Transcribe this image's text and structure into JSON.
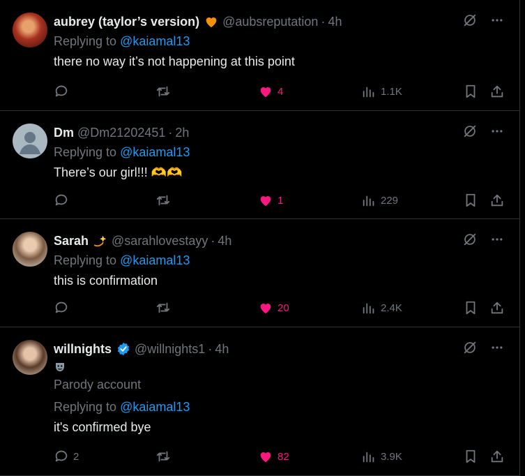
{
  "tweets": [
    {
      "name": "aubrey (taylor’s version)",
      "badge": "orange-heart",
      "handle": "@aubsreputation",
      "time": "4h",
      "replying_prefix": "Replying to",
      "replying_to": "@kaiamal13",
      "extra": "",
      "mask": false,
      "text": "there no way it’s not happening at this point",
      "replies": "",
      "likes": "4",
      "views": "1.1K",
      "avatar_color": "#b8472c"
    },
    {
      "name": "Dm",
      "badge": "",
      "handle": "@Dm21202451",
      "time": "2h",
      "replying_prefix": "Replying to",
      "replying_to": "@kaiamal13",
      "extra": "",
      "mask": false,
      "text": "There’s our girl!!! 🫶🫶",
      "replies": "",
      "likes": "1",
      "views": "229",
      "avatar_color": "#aab8c2"
    },
    {
      "name": "Sarah",
      "badge": "dizzy-star",
      "handle": "@sarahlovestayy",
      "time": "4h",
      "replying_prefix": "Replying to",
      "replying_to": "@kaiamal13",
      "extra": "",
      "mask": false,
      "text": "this is confirmation",
      "replies": "",
      "likes": "20",
      "views": "2.4K",
      "avatar_color": "#c9b8a4"
    },
    {
      "name": "willnights",
      "badge": "verified-check",
      "handle": "@willnights1",
      "time": "4h",
      "replying_prefix": "Replying to",
      "replying_to": "@kaiamal13",
      "extra": "Parody account",
      "mask": true,
      "text": "it's confirmed bye",
      "replies": "2",
      "likes": "82",
      "views": "3.9K",
      "avatar_color": "#caa98f"
    }
  ],
  "colors": {
    "like": "#f91880",
    "link": "#1d9bf0",
    "muted": "#71767b",
    "verified": "#1d9bf0"
  },
  "icons": [
    "grok-icon",
    "more-icon",
    "reply-icon",
    "retweet-icon",
    "heart-icon",
    "views-icon",
    "bookmark-icon",
    "share-icon"
  ]
}
